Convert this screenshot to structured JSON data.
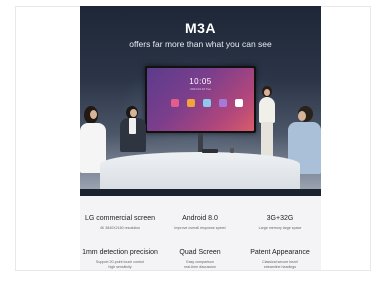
{
  "hero": {
    "title": "M3A",
    "subtitle": "offers far more than what you can see",
    "screen_time": "10:05",
    "screen_date": "2024.04.16 Tue",
    "app_icon_colors": [
      "#e35d8b",
      "#f3a33b",
      "#8ec8f0",
      "#a579d8",
      "#ffffff"
    ]
  },
  "features": [
    {
      "title": "LG commercial screen",
      "desc": "4K 3840X2160 resolution"
    },
    {
      "title": "Android 8.0",
      "desc": "Improve overall response speed"
    },
    {
      "title": "3G+32G",
      "desc": "Large memory  large space"
    },
    {
      "title": "1mm detection precision",
      "desc": "Support 20-point touch control\nhigh sensitivity"
    },
    {
      "title": "Quad Screen",
      "desc": "Easy comparison\nreal-time discussion"
    },
    {
      "title": "Patent Appearance",
      "desc": "Classical secure bezel\nstreamline headings"
    }
  ]
}
